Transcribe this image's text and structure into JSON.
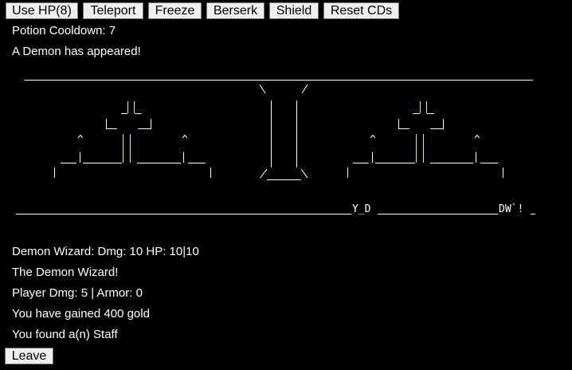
{
  "toolbar": {
    "buttons": [
      {
        "label": "Use HP(8)"
      },
      {
        "label": "Teleport"
      },
      {
        "label": "Freeze"
      },
      {
        "label": "Berserk"
      },
      {
        "label": "Shield"
      },
      {
        "label": "Reset CDs"
      }
    ]
  },
  "status": {
    "potion_cooldown": "Potion Cooldown: 7",
    "event": "A Demon has appeared!"
  },
  "map": {
    "row_left_marker": "Y_D",
    "row_right_marker": "DW`!"
  },
  "combat": {
    "enemy_stats": "Demon Wizard: Dmg: 10 HP: 10|10",
    "enemy_name": "The Demon Wizard!",
    "player_stats": "Player Dmg: 5 | Armor: 0",
    "gold_msg": "You have gained 400 gold",
    "item_msg": "You found a(n) Staff"
  },
  "actions": {
    "leave_label": "Leave"
  },
  "colors": {
    "background": "#000000",
    "text": "#ffffff",
    "torch_flame": "#f6f600",
    "button_face": "#efefef"
  }
}
